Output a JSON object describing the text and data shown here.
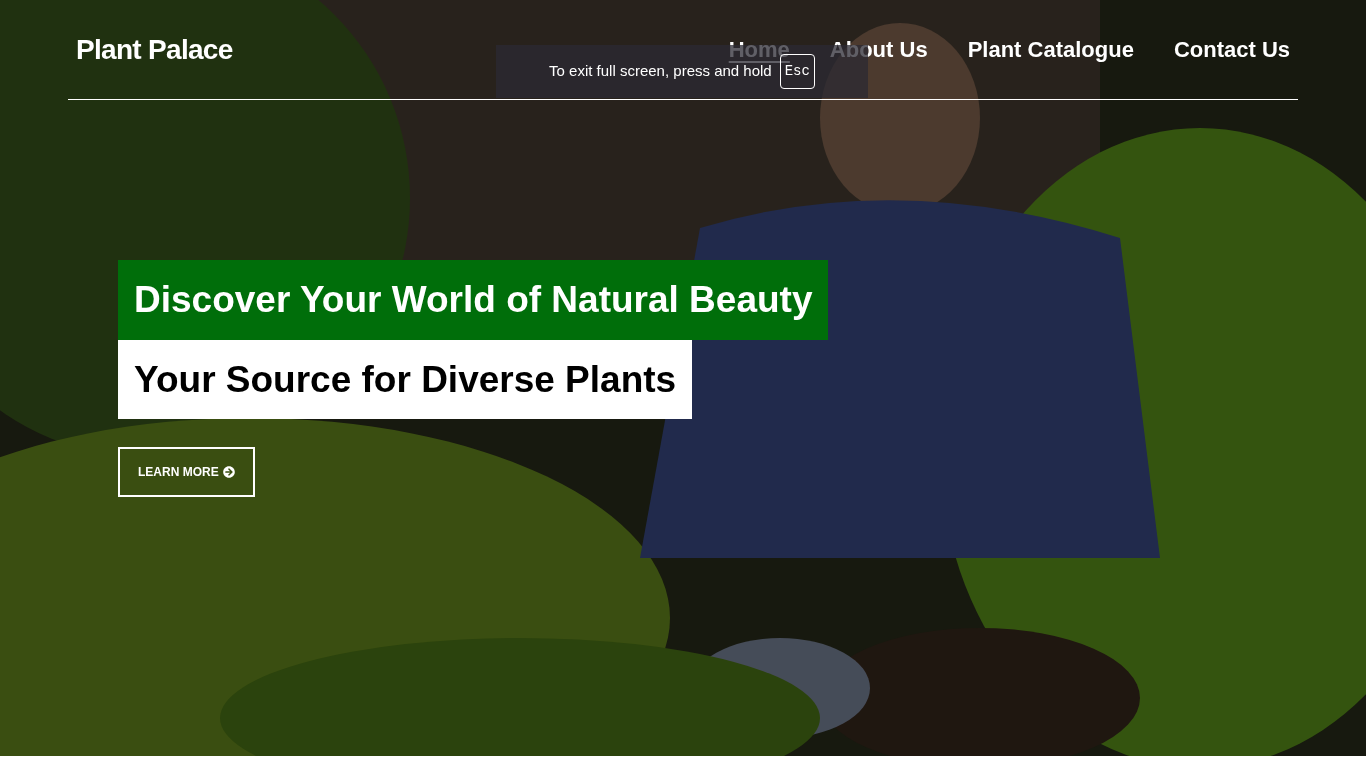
{
  "logo": "Plant Palace",
  "nav": [
    {
      "label": "Home",
      "selected": true
    },
    {
      "label": "About Us",
      "selected": false
    },
    {
      "label": "Plant Catalogue",
      "selected": false
    },
    {
      "label": "Contact Us",
      "selected": false
    }
  ],
  "fullscreen_notice": {
    "text": "To exit full screen, press and hold",
    "key": "Esc"
  },
  "hero": {
    "headline": "Discover Your World of Natural Beauty",
    "subheadline": "Your Source for Diverse Plants",
    "button": "LEARN MORE"
  }
}
